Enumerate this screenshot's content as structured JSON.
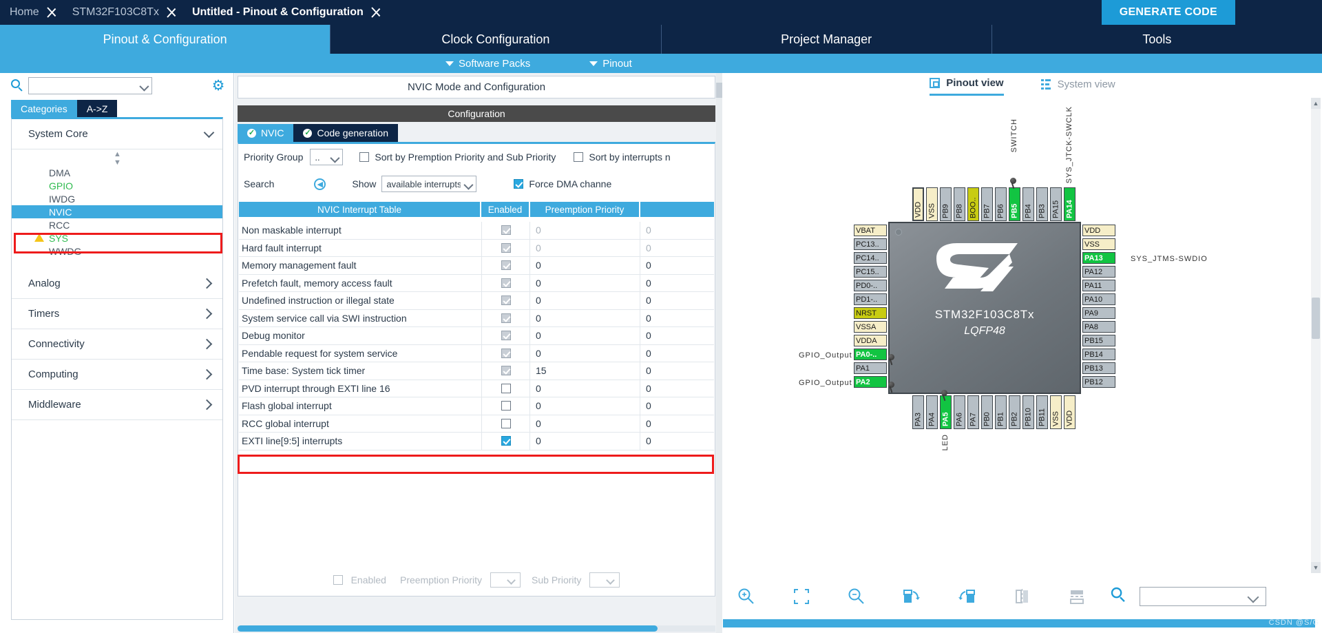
{
  "breadcrumb": {
    "items": [
      {
        "label": "Home",
        "active": false
      },
      {
        "label": "STM32F103C8Tx",
        "active": false
      },
      {
        "label": "Untitled - Pinout & Configuration",
        "active": true
      }
    ],
    "generate_code_label": "GENERATE CODE"
  },
  "main_tabs": [
    {
      "label": "Pinout & Configuration",
      "active": true
    },
    {
      "label": "Clock Configuration",
      "active": false
    },
    {
      "label": "Project Manager",
      "active": false
    },
    {
      "label": "Tools",
      "active": false
    }
  ],
  "sub_bar": {
    "software_packs": "Software Packs",
    "pinout": "Pinout"
  },
  "sidebar": {
    "search_value": "",
    "category_tabs": [
      {
        "label": "Categories",
        "selected": true
      },
      {
        "label": "A->Z",
        "selected": false
      }
    ],
    "groups": [
      {
        "label": "System Core",
        "expanded": true,
        "items": [
          {
            "label": "DMA",
            "state": "normal"
          },
          {
            "label": "GPIO",
            "state": "configured"
          },
          {
            "label": "IWDG",
            "state": "normal"
          },
          {
            "label": "NVIC",
            "state": "selected"
          },
          {
            "label": "RCC",
            "state": "normal"
          },
          {
            "label": "SYS",
            "state": "warning"
          },
          {
            "label": "WWDG",
            "state": "normal"
          }
        ]
      },
      {
        "label": "Analog",
        "expanded": false,
        "items": []
      },
      {
        "label": "Timers",
        "expanded": false,
        "items": []
      },
      {
        "label": "Connectivity",
        "expanded": false,
        "items": []
      },
      {
        "label": "Computing",
        "expanded": false,
        "items": []
      },
      {
        "label": "Middleware",
        "expanded": false,
        "items": []
      }
    ]
  },
  "config": {
    "mode_header": "NVIC Mode and Configuration",
    "configuration_header": "Configuration",
    "tabs": [
      {
        "label": "NVIC",
        "selected": true
      },
      {
        "label": "Code generation",
        "selected": false
      }
    ],
    "priority_group_label": "Priority Group",
    "priority_group_value": "..",
    "sort_premption_label": "Sort by Premption Priority and Sub Priority",
    "sort_premption_checked": false,
    "sort_interrupts_label": "Sort by interrupts n",
    "sort_interrupts_checked": false,
    "search_label": "Search",
    "show_label": "Show",
    "show_value": "available interrupts",
    "force_dma_label": "Force DMA channe",
    "force_dma_checked": true,
    "columns": [
      "NVIC Interrupt Table",
      "Enabled",
      "Preemption Priority",
      ""
    ],
    "rows": [
      {
        "name": "Non maskable interrupt",
        "enabled": true,
        "readonly": true,
        "preemption": "0",
        "sub": "0",
        "dim": true
      },
      {
        "name": "Hard fault interrupt",
        "enabled": true,
        "readonly": true,
        "preemption": "0",
        "sub": "0",
        "dim": true
      },
      {
        "name": "Memory management fault",
        "enabled": true,
        "readonly": true,
        "preemption": "0",
        "sub": "0",
        "dim": false
      },
      {
        "name": "Prefetch fault, memory access fault",
        "enabled": true,
        "readonly": true,
        "preemption": "0",
        "sub": "0",
        "dim": false
      },
      {
        "name": "Undefined instruction or illegal state",
        "enabled": true,
        "readonly": true,
        "preemption": "0",
        "sub": "0",
        "dim": false
      },
      {
        "name": "System service call via SWI instruction",
        "enabled": true,
        "readonly": true,
        "preemption": "0",
        "sub": "0",
        "dim": false
      },
      {
        "name": "Debug monitor",
        "enabled": true,
        "readonly": true,
        "preemption": "0",
        "sub": "0",
        "dim": false
      },
      {
        "name": "Pendable request for system service",
        "enabled": true,
        "readonly": true,
        "preemption": "0",
        "sub": "0",
        "dim": false
      },
      {
        "name": "Time base: System tick timer",
        "enabled": true,
        "readonly": true,
        "preemption": "15",
        "sub": "0",
        "dim": false
      },
      {
        "name": "PVD interrupt through EXTI line 16",
        "enabled": false,
        "readonly": false,
        "preemption": "0",
        "sub": "0",
        "dim": false
      },
      {
        "name": "Flash global interrupt",
        "enabled": false,
        "readonly": false,
        "preemption": "0",
        "sub": "0",
        "dim": false
      },
      {
        "name": "RCC global interrupt",
        "enabled": false,
        "readonly": false,
        "preemption": "0",
        "sub": "0",
        "dim": false
      },
      {
        "name": "EXTI line[9:5] interrupts",
        "enabled": true,
        "readonly": false,
        "preemption": "0",
        "sub": "0",
        "dim": false,
        "highlighted": true
      }
    ],
    "footer": {
      "enabled_label": "Enabled",
      "enabled_checked": false,
      "preemption_label": "Preemption Priority",
      "preemption_value": "",
      "sub_label": "Sub Priority",
      "sub_value": ""
    }
  },
  "pinout": {
    "view_tabs": [
      {
        "label": "Pinout view",
        "selected": true,
        "icon": "chip-icon"
      },
      {
        "label": "System view",
        "selected": false,
        "icon": "grid-icon"
      }
    ],
    "chip": {
      "part_number": "STM32F103C8Tx",
      "package": "LQFP48"
    },
    "top_pins": [
      {
        "label": "VDD",
        "type": "power"
      },
      {
        "label": "VSS",
        "type": "power"
      },
      {
        "label": "PB9",
        "type": "normal"
      },
      {
        "label": "PB8",
        "type": "normal"
      },
      {
        "label": "BOO..",
        "type": "boot"
      },
      {
        "label": "PB7",
        "type": "normal"
      },
      {
        "label": "PB6",
        "type": "normal"
      },
      {
        "label": "PB5",
        "type": "active"
      },
      {
        "label": "PB4",
        "type": "normal"
      },
      {
        "label": "PB3",
        "type": "normal"
      },
      {
        "label": "PA15",
        "type": "normal"
      },
      {
        "label": "PA14",
        "type": "active"
      }
    ],
    "top_labels": [
      {
        "text": "SWITCH",
        "pin": "PB5"
      },
      {
        "text": "SYS_JTCK-SWCLK",
        "pin": "PA14"
      }
    ],
    "left_pins": [
      {
        "label": "VBAT",
        "type": "power"
      },
      {
        "label": "PC13..",
        "type": "normal"
      },
      {
        "label": "PC14..",
        "type": "normal"
      },
      {
        "label": "PC15..",
        "type": "normal"
      },
      {
        "label": "PD0-..",
        "type": "normal"
      },
      {
        "label": "PD1-..",
        "type": "normal"
      },
      {
        "label": "NRST",
        "type": "nrst"
      },
      {
        "label": "VSSA",
        "type": "power"
      },
      {
        "label": "VDDA",
        "type": "power"
      },
      {
        "label": "PA0-..",
        "type": "active"
      },
      {
        "label": "PA1",
        "type": "normal"
      },
      {
        "label": "PA2",
        "type": "active"
      }
    ],
    "left_labels": [
      {
        "text": "GPIO_Output",
        "pin": "PA0-.."
      },
      {
        "text": "GPIO_Output",
        "pin": "PA2"
      }
    ],
    "right_pins": [
      {
        "label": "VDD",
        "type": "power"
      },
      {
        "label": "VSS",
        "type": "power"
      },
      {
        "label": "PA13",
        "type": "active"
      },
      {
        "label": "PA12",
        "type": "normal"
      },
      {
        "label": "PA11",
        "type": "normal"
      },
      {
        "label": "PA10",
        "type": "normal"
      },
      {
        "label": "PA9",
        "type": "normal"
      },
      {
        "label": "PA8",
        "type": "normal"
      },
      {
        "label": "PB15",
        "type": "normal"
      },
      {
        "label": "PB14",
        "type": "normal"
      },
      {
        "label": "PB13",
        "type": "normal"
      },
      {
        "label": "PB12",
        "type": "normal"
      }
    ],
    "right_labels": [
      {
        "text": "SYS_JTMS-SWDIO",
        "pin": "PA13"
      }
    ],
    "bottom_pins": [
      {
        "label": "PA3",
        "type": "normal"
      },
      {
        "label": "PA4",
        "type": "normal"
      },
      {
        "label": "PA5",
        "type": "active"
      },
      {
        "label": "PA6",
        "type": "normal"
      },
      {
        "label": "PA7",
        "type": "normal"
      },
      {
        "label": "PB0",
        "type": "normal"
      },
      {
        "label": "PB1",
        "type": "normal"
      },
      {
        "label": "PB2",
        "type": "normal"
      },
      {
        "label": "PB10",
        "type": "normal"
      },
      {
        "label": "PB11",
        "type": "normal"
      },
      {
        "label": "VSS",
        "type": "power"
      },
      {
        "label": "VDD",
        "type": "power"
      }
    ],
    "bottom_labels": [
      {
        "text": "LED",
        "pin": "PA5"
      }
    ],
    "toolbar": [
      {
        "name": "zoom-in-icon"
      },
      {
        "name": "fit-to-screen-icon"
      },
      {
        "name": "zoom-out-icon"
      },
      {
        "name": "rotate-right-icon"
      },
      {
        "name": "rotate-left-icon"
      },
      {
        "name": "flip-vertical-icon"
      },
      {
        "name": "toggle-table-icon"
      }
    ],
    "search_value": ""
  },
  "watermark": "CSDN @S/G",
  "colors": {
    "accent": "#3eaade",
    "dark_navy": "#0d2546",
    "pin_active": "#12c442",
    "pin_power": "#f6eec8",
    "pin_boot": "#c8cc12",
    "highlight_red": "#ee1b1b"
  }
}
